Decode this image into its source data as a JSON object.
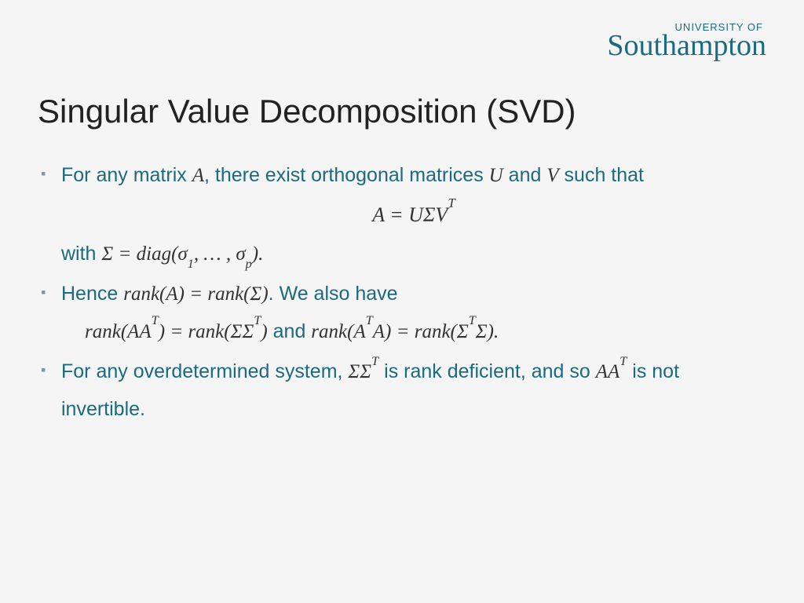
{
  "logo": {
    "top": "UNIVERSITY OF",
    "bottom": "Southampton"
  },
  "title": "Singular Value Decomposition (SVD)",
  "bullets": {
    "b1_pre": "For any matrix ",
    "b1_A": "A",
    "b1_mid1": ", there exist orthogonal matrices ",
    "b1_U": "U",
    "b1_mid2": " and ",
    "b1_V": "V",
    "b1_post": " such that",
    "eq1": "A = UΣV",
    "eq1_sup": "T",
    "with_pre": "with ",
    "with_math": "Σ = diag(σ",
    "with_sub1": "1",
    "with_mid": ", … , σ",
    "with_subp": "p",
    "with_end": ").",
    "b2_pre": "Hence ",
    "b2_m1": "rank(A) = rank(Σ)",
    "b2_post": ". We also have",
    "eq2_a": "rank(AA",
    "eq2_aT": "T",
    "eq2_b": ") = rank(ΣΣ",
    "eq2_bT": "T",
    "eq2_c": ")",
    "eq2_and": " and ",
    "eq2_d": "rank(A",
    "eq2_dT": "T",
    "eq2_e": "A) = rank(Σ",
    "eq2_eT": "T",
    "eq2_f": "Σ).",
    "b3_pre": "For any overdetermined system, ",
    "b3_m1": "ΣΣ",
    "b3_m1T": "T",
    "b3_mid": " is rank deficient, and so ",
    "b3_m2": "AA",
    "b3_m2T": "T",
    "b3_post": " is not invertible."
  }
}
